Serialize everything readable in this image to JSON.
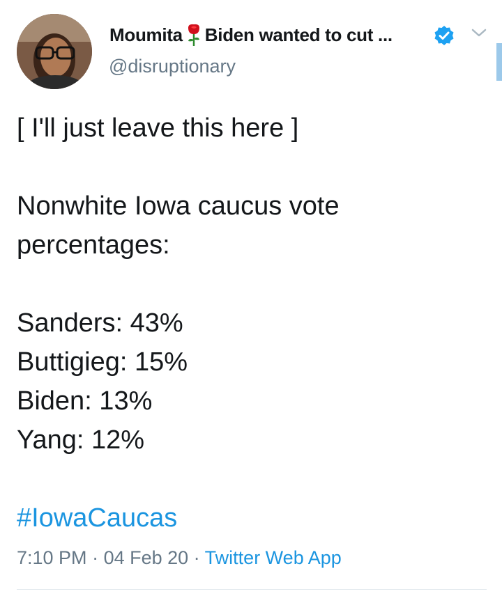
{
  "author": {
    "name": "Moumita",
    "name_suffix": "Biden wanted to cut ...",
    "handle": "@disruptionary",
    "emoji_icon": "rose-icon",
    "verified": true
  },
  "tweet": {
    "lines": [
      "[ I'll just leave this here ]",
      "",
      "Nonwhite Iowa caucus vote",
      "percentages:",
      "",
      "Sanders: 43%",
      "Buttigieg: 15%",
      "Biden: 13%",
      "Yang: 12%",
      ""
    ],
    "hashtag": "#IowaCaucas"
  },
  "meta": {
    "time": "7:10 PM",
    "separator": " · ",
    "date": "04 Feb 20",
    "source": "Twitter Web App"
  },
  "colors": {
    "link": "#1b95e0",
    "secondary_text": "#657786",
    "primary_text": "#14171a",
    "verified_badge": "#1da1f2"
  }
}
